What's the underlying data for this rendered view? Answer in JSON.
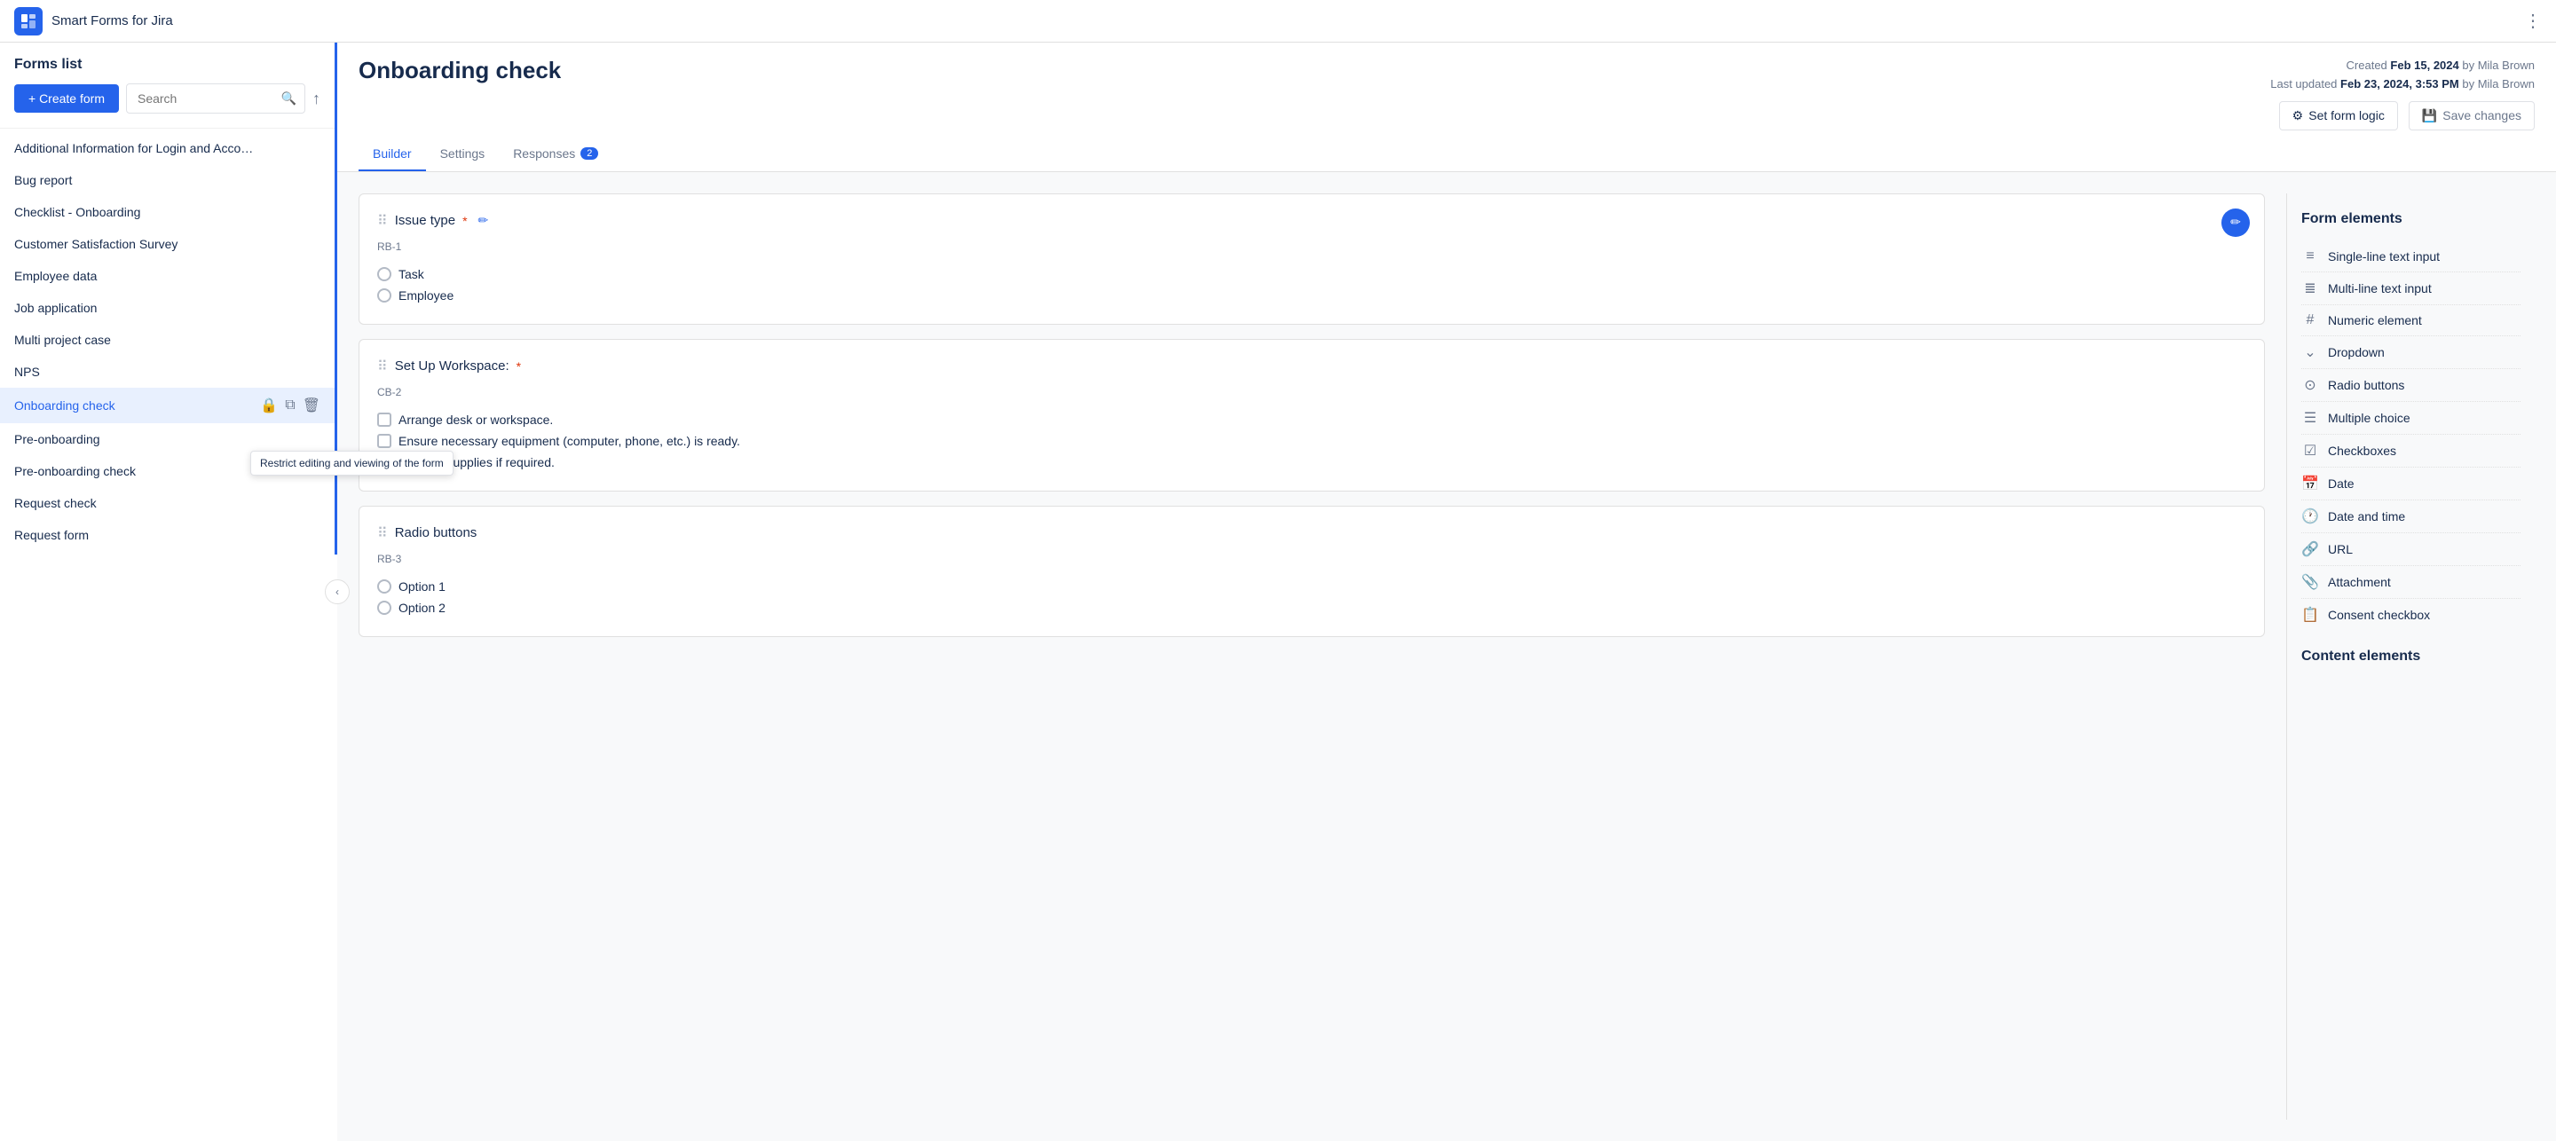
{
  "app": {
    "title": "Smart Forms for Jira",
    "more_icon": "⋮"
  },
  "sidebar": {
    "title": "Forms list",
    "create_btn": "+ Create form",
    "search_placeholder": "Search",
    "items": [
      {
        "id": "additional",
        "label": "Additional Information for Login and Acco…",
        "active": false
      },
      {
        "id": "bug-report",
        "label": "Bug report",
        "active": false
      },
      {
        "id": "checklist",
        "label": "Checklist - Onboarding",
        "active": false
      },
      {
        "id": "customer-satisfaction",
        "label": "Customer Satisfaction Survey",
        "active": false
      },
      {
        "id": "employee-data",
        "label": "Employee data",
        "active": false
      },
      {
        "id": "job-application",
        "label": "Job application",
        "active": false
      },
      {
        "id": "multi-project",
        "label": "Multi project case",
        "active": false
      },
      {
        "id": "nps",
        "label": "NPS",
        "active": false
      },
      {
        "id": "onboarding-check",
        "label": "Onboarding check",
        "active": true
      },
      {
        "id": "pre-onboarding",
        "label": "Pre-onboarding",
        "active": false
      },
      {
        "id": "pre-onboarding-check",
        "label": "Pre-onboarding check",
        "active": false
      },
      {
        "id": "request-check",
        "label": "Request check",
        "active": false
      },
      {
        "id": "request-form",
        "label": "Request form",
        "active": false
      }
    ],
    "tooltip": "Restrict editing and viewing of the form"
  },
  "header": {
    "page_title": "Onboarding check",
    "meta_created": "Created",
    "meta_created_date": "Feb 15, 2024",
    "meta_created_by": "by Mila Brown",
    "meta_updated": "Last updated",
    "meta_updated_date": "Feb 23, 2024, 3:53 PM",
    "meta_updated_by": "by Mila Brown",
    "set_logic_btn": "Set form logic",
    "save_changes_btn": "Save changes"
  },
  "tabs": [
    {
      "id": "builder",
      "label": "Builder",
      "active": true,
      "badge": null
    },
    {
      "id": "settings",
      "label": "Settings",
      "active": false,
      "badge": null
    },
    {
      "id": "responses",
      "label": "Responses",
      "active": false,
      "badge": "2"
    }
  ],
  "form_cards": [
    {
      "id": "card1",
      "field_label": "Issue type",
      "required": true,
      "has_edit": true,
      "code": "RB-1",
      "type": "radio",
      "options": [
        "Task",
        "Employee"
      ]
    },
    {
      "id": "card2",
      "field_label": "Set Up Workspace:",
      "required": true,
      "has_edit": false,
      "code": "CB-2",
      "type": "checkbox",
      "options": [
        "Arrange desk or workspace.",
        "Ensure necessary equipment (computer, phone, etc.) is ready.",
        "…itional supplies if required."
      ]
    },
    {
      "id": "card3",
      "field_label": "Radio buttons",
      "required": false,
      "has_edit": false,
      "code": "RB-3",
      "type": "radio",
      "options": [
        "Option 1",
        "Option 2"
      ]
    }
  ],
  "right_panel": {
    "form_elements_title": "Form elements",
    "elements": [
      {
        "id": "single-line",
        "icon": "≡",
        "label": "Single-line text input"
      },
      {
        "id": "multi-line",
        "icon": "≣",
        "label": "Multi-line text input"
      },
      {
        "id": "numeric",
        "icon": "#",
        "label": "Numeric element"
      },
      {
        "id": "dropdown",
        "icon": "⌄",
        "label": "Dropdown"
      },
      {
        "id": "radio",
        "icon": "⊙",
        "label": "Radio buttons"
      },
      {
        "id": "multiple-choice",
        "icon": "☰",
        "label": "Multiple choice"
      },
      {
        "id": "checkboxes",
        "icon": "☑",
        "label": "Checkboxes"
      },
      {
        "id": "date",
        "icon": "📅",
        "label": "Date"
      },
      {
        "id": "date-time",
        "icon": "🕐",
        "label": "Date and time"
      },
      {
        "id": "url",
        "icon": "🔗",
        "label": "URL"
      },
      {
        "id": "attachment",
        "icon": "📎",
        "label": "Attachment"
      },
      {
        "id": "consent",
        "icon": "📋",
        "label": "Consent checkbox"
      }
    ],
    "content_elements_title": "Content elements"
  }
}
